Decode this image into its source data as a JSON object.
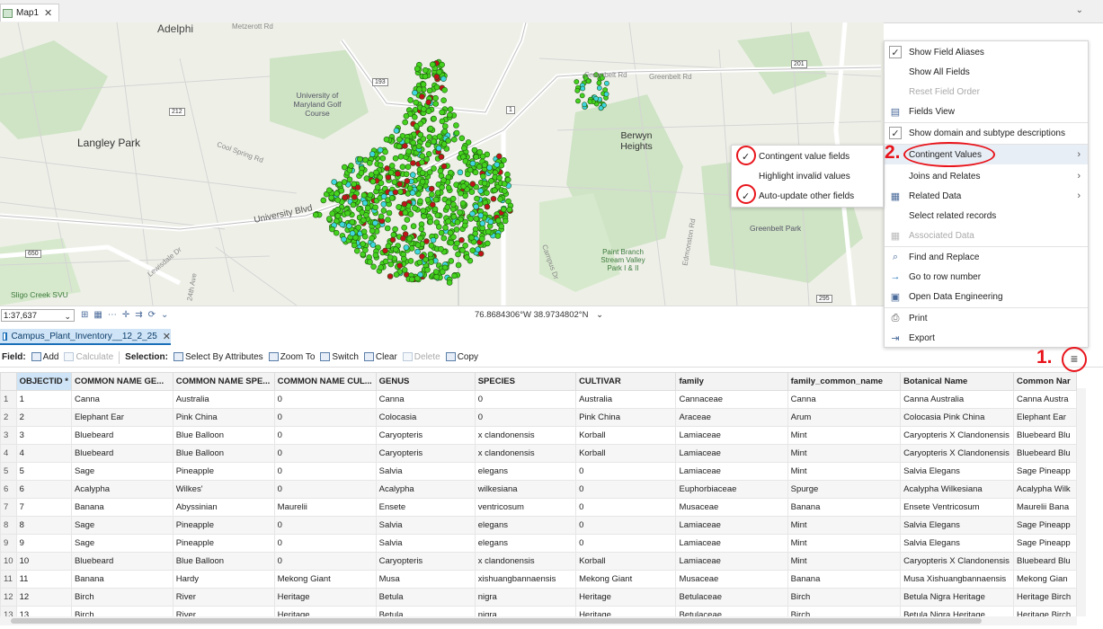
{
  "tabs": {
    "map_tab": "Map1",
    "table_tab": "Campus_Plant_Inventory__12_2_25"
  },
  "map": {
    "labels": {
      "adelphi": "Adelphi",
      "metzerott": "Metzerott Rd",
      "langley_park": "Langley Park",
      "umd_golf": "University of Maryland Golf Course",
      "cool_spring": "Cool Spring Rd",
      "university_blvd": "University Blvd",
      "lewisdale": "Lewisdale Dr",
      "ave24": "24th Ave",
      "sligo": "Sligo Creek SVU",
      "berwyn": "Berwyn Heights",
      "greenbelt_rd_1": "Greenbelt Rd",
      "greenbelt_rd_2": "Greenbelt Rd",
      "greenbelt_park": "Greenbelt Park",
      "paint_branch": "Paint Branch Stream Valley Park I & II",
      "edmonston": "Edmonston Rd",
      "campus_dr": "Campus Dr"
    },
    "shields": {
      "s193": "193",
      "s212": "212",
      "s1": "1",
      "s650": "650",
      "s201": "201",
      "s295": "295"
    }
  },
  "status": {
    "scale": "1:37,637",
    "coordinates": "76.8684306°W 38.9734802°N"
  },
  "toolbar": {
    "field_label": "Field:",
    "add": "Add",
    "calculate": "Calculate",
    "selection_label": "Selection:",
    "select_by_attributes": "Select By Attributes",
    "zoom_to": "Zoom To",
    "switch": "Switch",
    "clear": "Clear",
    "delete": "Delete",
    "copy": "Copy"
  },
  "menu": {
    "show_field_aliases": "Show Field Aliases",
    "show_all_fields": "Show All Fields",
    "reset_field_order": "Reset Field Order",
    "fields_view": "Fields View",
    "show_domain": "Show domain and subtype descriptions",
    "contingent_values": "Contingent Values",
    "joins_relates": "Joins and Relates",
    "related_data": "Related Data",
    "select_related": "Select related records",
    "associated_data": "Associated Data",
    "find_replace": "Find and Replace",
    "go_to_row": "Go to row number",
    "open_data_engineering": "Open Data Engineering",
    "print": "Print",
    "export": "Export"
  },
  "submenu": {
    "contingent_fields": "Contingent value fields",
    "highlight_invalid": "Highlight invalid values",
    "auto_update": "Auto-update other fields"
  },
  "annotations": {
    "step1": "1.",
    "step2": "2."
  },
  "table": {
    "columns": [
      "OBJECTID *",
      "COMMON NAME GE...",
      "COMMON NAME SPE...",
      "COMMON NAME CUL...",
      "GENUS",
      "SPECIES",
      "CULTIVAR",
      "family",
      "family_common_name",
      "Botanical Name",
      "Common Nar"
    ],
    "rows": [
      [
        "1",
        "1",
        "Canna",
        "Australia",
        "0",
        "Canna",
        "0",
        "Australia",
        "Cannaceae",
        "Canna",
        "Canna Australia",
        "Canna Austra"
      ],
      [
        "2",
        "2",
        "Elephant Ear",
        "Pink China",
        "0",
        "Colocasia",
        "0",
        "Pink China",
        "Araceae",
        "Arum",
        "Colocasia Pink China",
        "Elephant Ear"
      ],
      [
        "3",
        "3",
        "Bluebeard",
        "Blue Balloon",
        "0",
        "Caryopteris",
        "x clandonensis",
        "Korball",
        "Lamiaceae",
        "Mint",
        "Caryopteris X Clandonensis",
        "Bluebeard Blu"
      ],
      [
        "4",
        "4",
        "Bluebeard",
        "Blue Balloon",
        "0",
        "Caryopteris",
        "x clandonensis",
        "Korball",
        "Lamiaceae",
        "Mint",
        "Caryopteris X Clandonensis",
        "Bluebeard Blu"
      ],
      [
        "5",
        "5",
        "Sage",
        "Pineapple",
        "0",
        "Salvia",
        "elegans",
        "0",
        "Lamiaceae",
        "Mint",
        "Salvia Elegans",
        "Sage Pineapp"
      ],
      [
        "6",
        "6",
        "Acalypha",
        "Wilkes'",
        "0",
        "Acalypha",
        "wilkesiana",
        "0",
        "Euphorbiaceae",
        "Spurge",
        "Acalypha Wilkesiana",
        "Acalypha Wilk"
      ],
      [
        "7",
        "7",
        "Banana",
        "Abyssinian",
        "Maurelii",
        "Ensete",
        "ventricosum",
        "0",
        "Musaceae",
        "Banana",
        "Ensete Ventricosum",
        "Maurelii Bana"
      ],
      [
        "8",
        "8",
        "Sage",
        "Pineapple",
        "0",
        "Salvia",
        "elegans",
        "0",
        "Lamiaceae",
        "Mint",
        "Salvia Elegans",
        "Sage Pineapp"
      ],
      [
        "9",
        "9",
        "Sage",
        "Pineapple",
        "0",
        "Salvia",
        "elegans",
        "0",
        "Lamiaceae",
        "Mint",
        "Salvia Elegans",
        "Sage Pineapp"
      ],
      [
        "10",
        "10",
        "Bluebeard",
        "Blue Balloon",
        "0",
        "Caryopteris",
        "x clandonensis",
        "Korball",
        "Lamiaceae",
        "Mint",
        "Caryopteris X Clandonensis",
        "Bluebeard Blu"
      ],
      [
        "11",
        "11",
        "Banana",
        "Hardy",
        "Mekong Giant",
        "Musa",
        "xishuangbannaensis",
        "Mekong Giant",
        "Musaceae",
        "Banana",
        "Musa Xishuangbannaensis",
        "Mekong Gian"
      ],
      [
        "12",
        "12",
        "Birch",
        "River",
        "Heritage",
        "Betula",
        "nigra",
        "Heritage",
        "Betulaceae",
        "Birch",
        "Betula Nigra Heritage",
        "Heritage Birch"
      ],
      [
        "13",
        "13",
        "Birch",
        "River",
        "Heritage",
        "Betula",
        "nigra",
        "Heritage",
        "Betulaceae",
        "Birch",
        "Betula Nigra Heritage",
        "Heritage Birch"
      ]
    ]
  }
}
